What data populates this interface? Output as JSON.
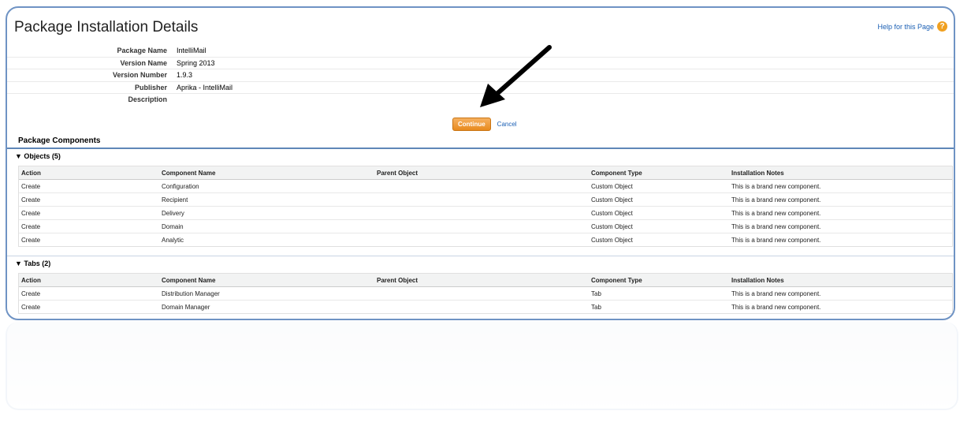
{
  "header": {
    "title": "Package Installation Details",
    "help_label": "Help for this Page",
    "help_icon": "question-icon"
  },
  "details": [
    {
      "label": "Package Name",
      "value": "IntelliMail"
    },
    {
      "label": "Version Name",
      "value": "Spring 2013"
    },
    {
      "label": "Version Number",
      "value": "1.9.3"
    },
    {
      "label": "Publisher",
      "value": "Aprika - IntelliMail"
    },
    {
      "label": "Description",
      "value": ""
    }
  ],
  "actions": {
    "continue_label": "Continue",
    "cancel_label": "Cancel"
  },
  "components": {
    "title": "Package Components",
    "columns": [
      "Action",
      "Component Name",
      "Parent Object",
      "Component Type",
      "Installation Notes"
    ],
    "objects": {
      "heading": "▼ Objects (5)",
      "rows": [
        [
          "Create",
          "Configuration",
          "",
          "Custom Object",
          "This is a brand new component."
        ],
        [
          "Create",
          "Recipient",
          "",
          "Custom Object",
          "This is a brand new component."
        ],
        [
          "Create",
          "Delivery",
          "",
          "Custom Object",
          "This is a brand new component."
        ],
        [
          "Create",
          "Domain",
          "",
          "Custom Object",
          "This is a brand new component."
        ],
        [
          "Create",
          "Analytic",
          "",
          "Custom Object",
          "This is a brand new component."
        ]
      ]
    },
    "tabs": {
      "heading": "▼ Tabs (2)",
      "rows": [
        [
          "Create",
          "Distribution Manager",
          "",
          "Tab",
          "This is a brand new component."
        ],
        [
          "Create",
          "Domain Manager",
          "",
          "Tab",
          "This is a brand new component."
        ]
      ]
    }
  },
  "colors": {
    "frame": "#6f93c4",
    "button": "#e88a1e",
    "link": "#1a5fb4"
  }
}
